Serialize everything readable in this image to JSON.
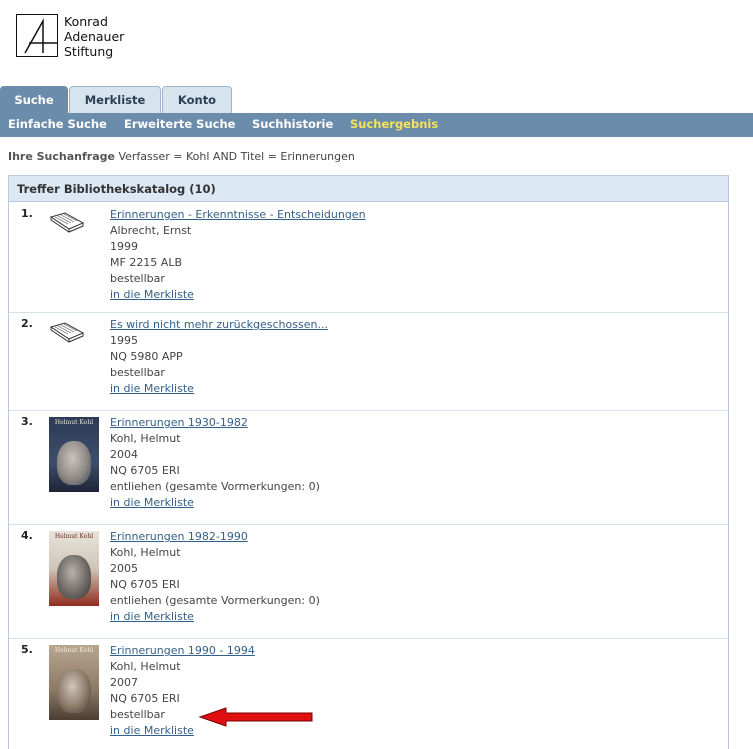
{
  "logo": {
    "line1": "Konrad",
    "line2": "Adenauer",
    "line3": "Stiftung"
  },
  "tabs": [
    {
      "label": "Suche",
      "active": true
    },
    {
      "label": "Merkliste",
      "active": false
    },
    {
      "label": "Konto",
      "active": false
    }
  ],
  "subnav": [
    {
      "label": "Einfache Suche"
    },
    {
      "label": "Erweiterte Suche"
    },
    {
      "label": "Suchhistorie"
    },
    {
      "label": "Suchergebnis",
      "current": true
    }
  ],
  "query": {
    "label": "Ihre Suchanfrage",
    "value": "Verfasser = Kohl AND Titel = Erinnerungen"
  },
  "results": {
    "header": "Treffer Bibliothekskatalog (10)",
    "items": [
      {
        "num": "1.",
        "thumb": "book-icon",
        "title": "Erinnerungen - Erkenntnisse - Entscheidungen",
        "author": "Albrecht, Ernst",
        "year": "1999",
        "signature": "MF 2215 ALB",
        "status": "bestellbar",
        "link": "in die Merkliste"
      },
      {
        "num": "2.",
        "thumb": "book-icon",
        "title": "Es wird nicht mehr zurückgeschossen...",
        "year": "1995",
        "signature": "NQ 5980 APP",
        "status": "bestellbar",
        "link": "in die Merkliste"
      },
      {
        "num": "3.",
        "thumb": "book-cover",
        "cover_caption": "Helmut Kohl",
        "title": "Erinnerungen 1930-1982",
        "author": "Kohl, Helmut",
        "year": "2004",
        "signature": "NQ 6705 ERI",
        "status": "entliehen (gesamte Vormerkungen: 0)",
        "link": "in die Merkliste"
      },
      {
        "num": "4.",
        "thumb": "book-cover",
        "cover_caption": "Helmut Kohl",
        "title": "Erinnerungen 1982-1990",
        "author": "Kohl, Helmut",
        "year": "2005",
        "signature": "NQ 6705 ERI",
        "status": "entliehen (gesamte Vormerkungen: 0)",
        "link": "in die Merkliste"
      },
      {
        "num": "5.",
        "thumb": "book-cover",
        "cover_caption": "Helmut Kohl",
        "title": "Erinnerungen 1990 - 1994",
        "author": "Kohl, Helmut",
        "year": "2007",
        "signature": "NQ 6705 ERI",
        "status": "bestellbar",
        "link": "in die Merkliste"
      }
    ]
  },
  "colors": {
    "nav": "#6b8cab",
    "current": "#f7e35a",
    "link": "#335f8a",
    "arrow": "#e01010"
  }
}
